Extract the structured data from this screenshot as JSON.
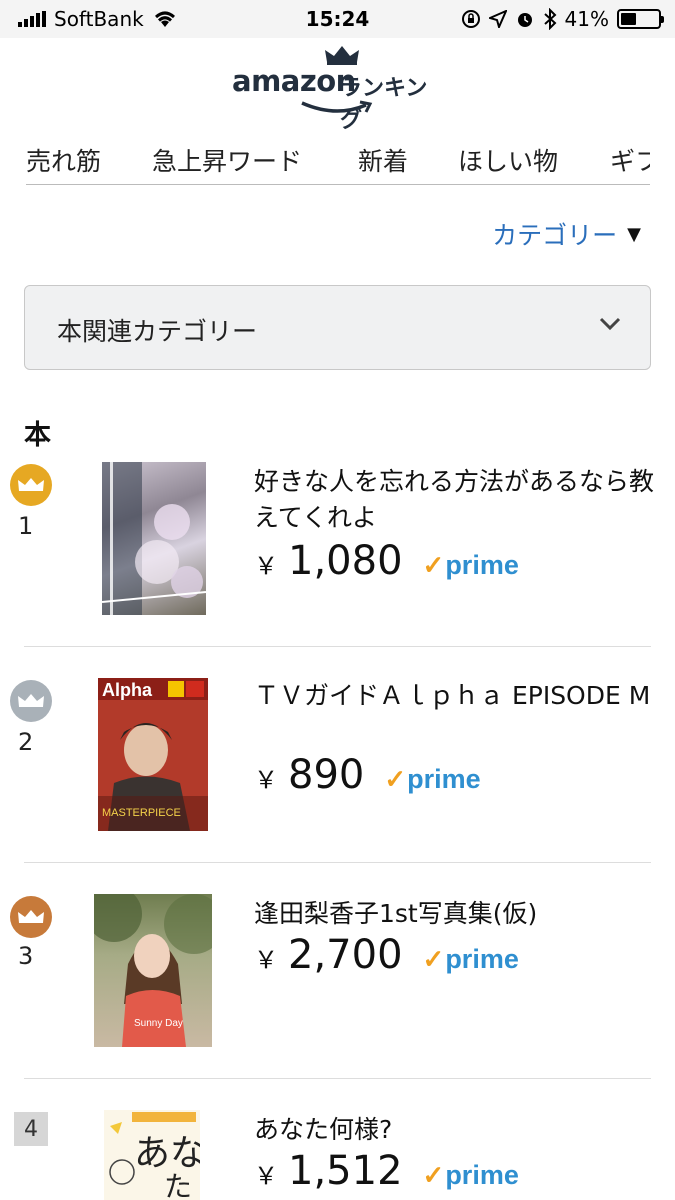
{
  "status_bar": {
    "carrier": "SoftBank",
    "time": "15:24",
    "battery": "41%",
    "battery_level": 0.41
  },
  "header": {
    "logo_text": "amazon",
    "logo_suffix": "ランキング"
  },
  "tabs": [
    {
      "label": "売れ筋"
    },
    {
      "label": "急上昇ワード"
    },
    {
      "label": "新着"
    },
    {
      "label": "ほしい物"
    },
    {
      "label": "ギフト"
    }
  ],
  "category_link": {
    "label": "カテゴリー",
    "caret": "▼"
  },
  "dropdown": {
    "label": "本関連カテゴリー"
  },
  "section_title": "本",
  "items": [
    {
      "rank": "1",
      "title": "好きな人を忘れる方法があるなら教えてくれよ",
      "yen": "￥",
      "price": "1,080",
      "prime": "prime",
      "badge": "gold"
    },
    {
      "rank": "2",
      "title": "ＴＶガイドＡｌｐｈａ EPISODE M",
      "yen": "￥",
      "price": "890",
      "prime": "prime",
      "badge": "silver"
    },
    {
      "rank": "3",
      "title": "逢田梨香子1st写真集(仮)",
      "yen": "￥",
      "price": "2,700",
      "prime": "prime",
      "badge": "bronze"
    },
    {
      "rank": "4",
      "title": "あなた何様?",
      "yen": "￥",
      "price": "1,512",
      "prime": "prime",
      "badge": "none"
    }
  ],
  "colors": {
    "link_blue": "#2a6ebb",
    "prime_blue": "#2f8fd0",
    "prime_check": "#f0a020",
    "gold": "#e6a823",
    "silver": "#a9b1b8",
    "bronze": "#c77a3a"
  },
  "icons": {
    "crown": "crown-icon",
    "chevron": "chevron-down-icon",
    "wifi": "wifi-icon",
    "alarm": "alarm-icon",
    "bluetooth": "bluetooth-icon",
    "location": "location-icon",
    "lock_rotation": "rotation-lock-icon"
  }
}
